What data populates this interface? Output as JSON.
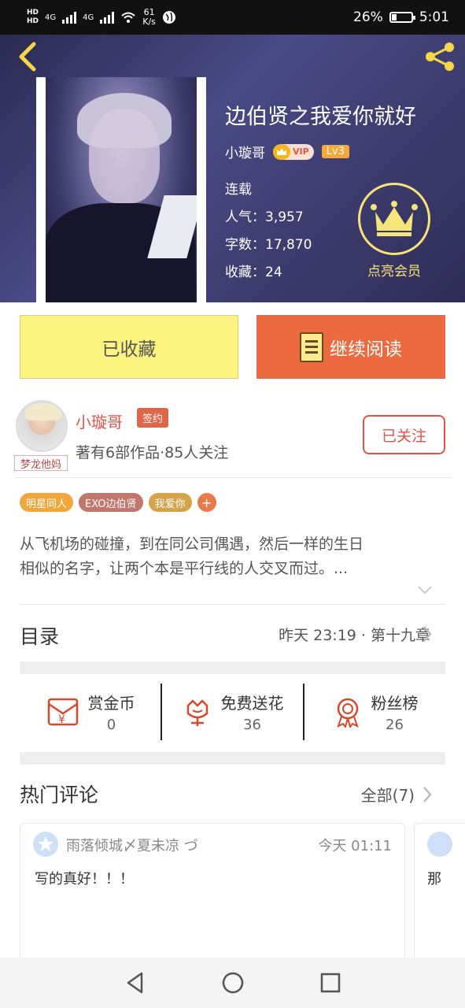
{
  "status_bar": {
    "net_hd_1": "HD",
    "net_hd_2": "HD",
    "signal_1": "4G",
    "signal_2": "4G",
    "speed_value": "61",
    "speed_unit": "K/s",
    "battery": "26%",
    "battery_level": 0.26,
    "time": "5:01"
  },
  "header": {
    "book_title": "边伯贤之我爱你就好",
    "author": "小璇哥",
    "vip_label": "VIP",
    "level": "Lv3",
    "status": "连载",
    "popularity_label": "人气：",
    "popularity": "3,957",
    "words_label": "字数：",
    "words": "17,870",
    "favorites_label": "收藏：",
    "favorites": "24",
    "member_label": "点亮会员"
  },
  "actions": {
    "favorited": "已收藏",
    "continue_reading": "继续阅读"
  },
  "author_section": {
    "name": "小璇哥",
    "sign_badge": "签约",
    "avatar_tag": "梦龙他妈",
    "meta": "著有6部作品·85人关注",
    "follow_label": "已关注"
  },
  "tags": [
    {
      "label": "明星同人",
      "color": "#f2a73c"
    },
    {
      "label": "EXO边伯贤",
      "color": "#c2776d"
    },
    {
      "label": "我爱你",
      "color": "#d4a34a"
    }
  ],
  "summary": {
    "line1": "从飞机场的碰撞，到在同公司偶遇，然后一样的生日",
    "line2": "相似的名字，让两个本是平行线的人交叉而过。..."
  },
  "toc": {
    "title": "目录",
    "latest": "昨天 23:19 · 第十九章"
  },
  "rewards": [
    {
      "label": "赏金币",
      "count": "0"
    },
    {
      "label": "免费送花",
      "count": "36"
    },
    {
      "label": "粉丝榜",
      "count": "26"
    }
  ],
  "comments": {
    "title": "热门评论",
    "all_label": "全部(7)",
    "items": [
      {
        "user": "雨落倾城〆夏未凉 づ",
        "time": "今天 01:11",
        "text": "写的真好！！！"
      },
      {
        "text": "那"
      }
    ]
  },
  "colors": {
    "accent": "#ec6a3e",
    "fav_button": "#fcf47e",
    "member_gold": "#f5e47a",
    "author_red": "#e0534a"
  }
}
